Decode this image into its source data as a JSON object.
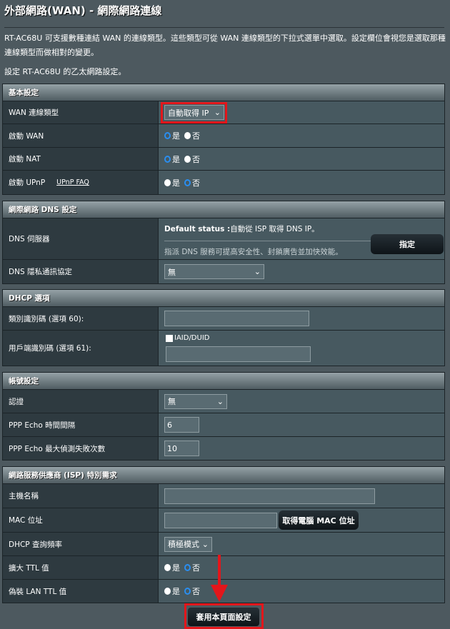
{
  "header": {
    "title": "外部網路(WAN) - 網際網路連線",
    "description": "RT-AC68U 可支援數種連結 WAN 的連線類型。這些類型可從 WAN 連線類型的下拉式選單中選取。設定欄位會視您是選取那種連線類型而做相對的變更。",
    "subtitle": "設定 RT-AC68U 的乙太網路設定。"
  },
  "radio": {
    "yes": "是",
    "no": "否"
  },
  "basic": {
    "title": "基本設定",
    "wan_type_label": "WAN 連線類型",
    "wan_type_value": "自動取得 IP",
    "enable_wan": "啟動 WAN",
    "enable_nat": "啟動 NAT",
    "enable_upnp": "啟動 UPnP",
    "upnp_faq": "UPnP FAQ"
  },
  "dns": {
    "title": "網際網路 DNS 設定",
    "server_label": "DNS 伺服器",
    "default_status_label": "Default status :",
    "default_status_value": "自動從 ISP 取得 DNS IP。",
    "hint": "指派 DNS 服務可提高安全性、封鎖廣告並加快效能。",
    "assign_button": "指定",
    "privacy_label": "DNS 隱私通訊協定",
    "privacy_value": "無"
  },
  "dhcp": {
    "title": "DHCP 選項",
    "vendor_label": "類別識別碼 (選項 60):",
    "vendor_value": "",
    "client_label": "用戶端識別碼 (選項 61):",
    "iaid_label": "IAID/DUID",
    "client_value": ""
  },
  "account": {
    "title": "帳號設定",
    "auth_label": "認證",
    "auth_value": "無",
    "echo_interval_label": "PPP Echo 時間間隔",
    "echo_interval_value": "6",
    "echo_fail_label": "PPP Echo 最大偵測失敗次數",
    "echo_fail_value": "10"
  },
  "isp": {
    "title": "網路服務供應商 (ISP) 特別需求",
    "hostname_label": "主機名稱",
    "hostname_value": "",
    "mac_label": "MAC 位址",
    "mac_value": "",
    "mac_button": "取得電腦 MAC 位址",
    "dhcp_freq_label": "DHCP 查詢頻率",
    "dhcp_freq_value": "積極模式",
    "extend_ttl_label": "擴大 TTL 值",
    "spoof_ttl_label": "偽裝 LAN TTL 值"
  },
  "apply_button": "套用本頁面設定",
  "colors": {
    "highlight": "#e3161b",
    "radio_selected": "#2a8ef0"
  }
}
